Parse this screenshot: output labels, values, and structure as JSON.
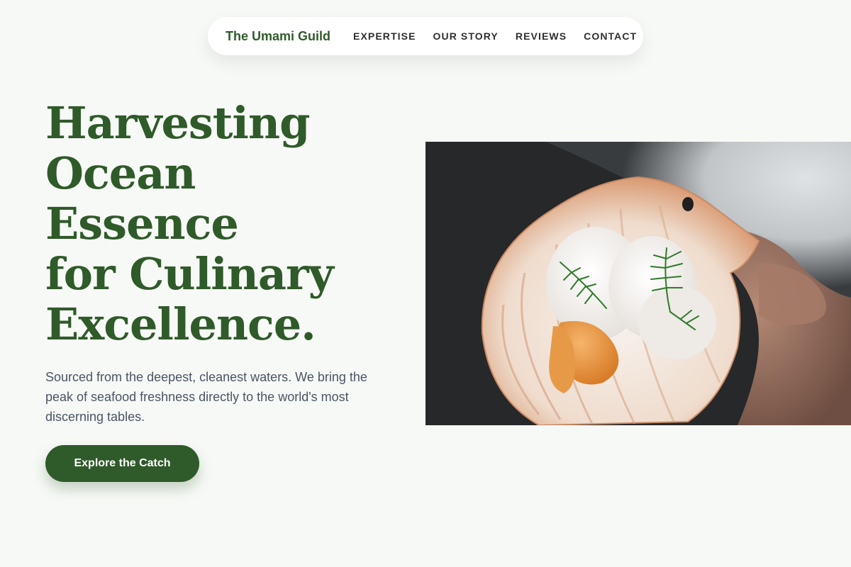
{
  "nav": {
    "brand": "The Umami Guild",
    "links": [
      {
        "label": "EXPERTISE"
      },
      {
        "label": "OUR STORY"
      },
      {
        "label": "REVIEWS"
      },
      {
        "label": "CONTACT"
      }
    ]
  },
  "hero": {
    "headline_lines": [
      "Harvesting",
      "Ocean",
      "Essence",
      "for Culinary",
      "Excellence."
    ],
    "subcopy": "Sourced from the deepest, cleanest waters. We bring the peak of seafood freshness directly to the world's most discerning tables.",
    "cta_label": "Explore the Catch"
  },
  "colors": {
    "brand_green": "#2f5a29",
    "page_background": "#f7f9f6",
    "body_text": "#4b5563"
  }
}
